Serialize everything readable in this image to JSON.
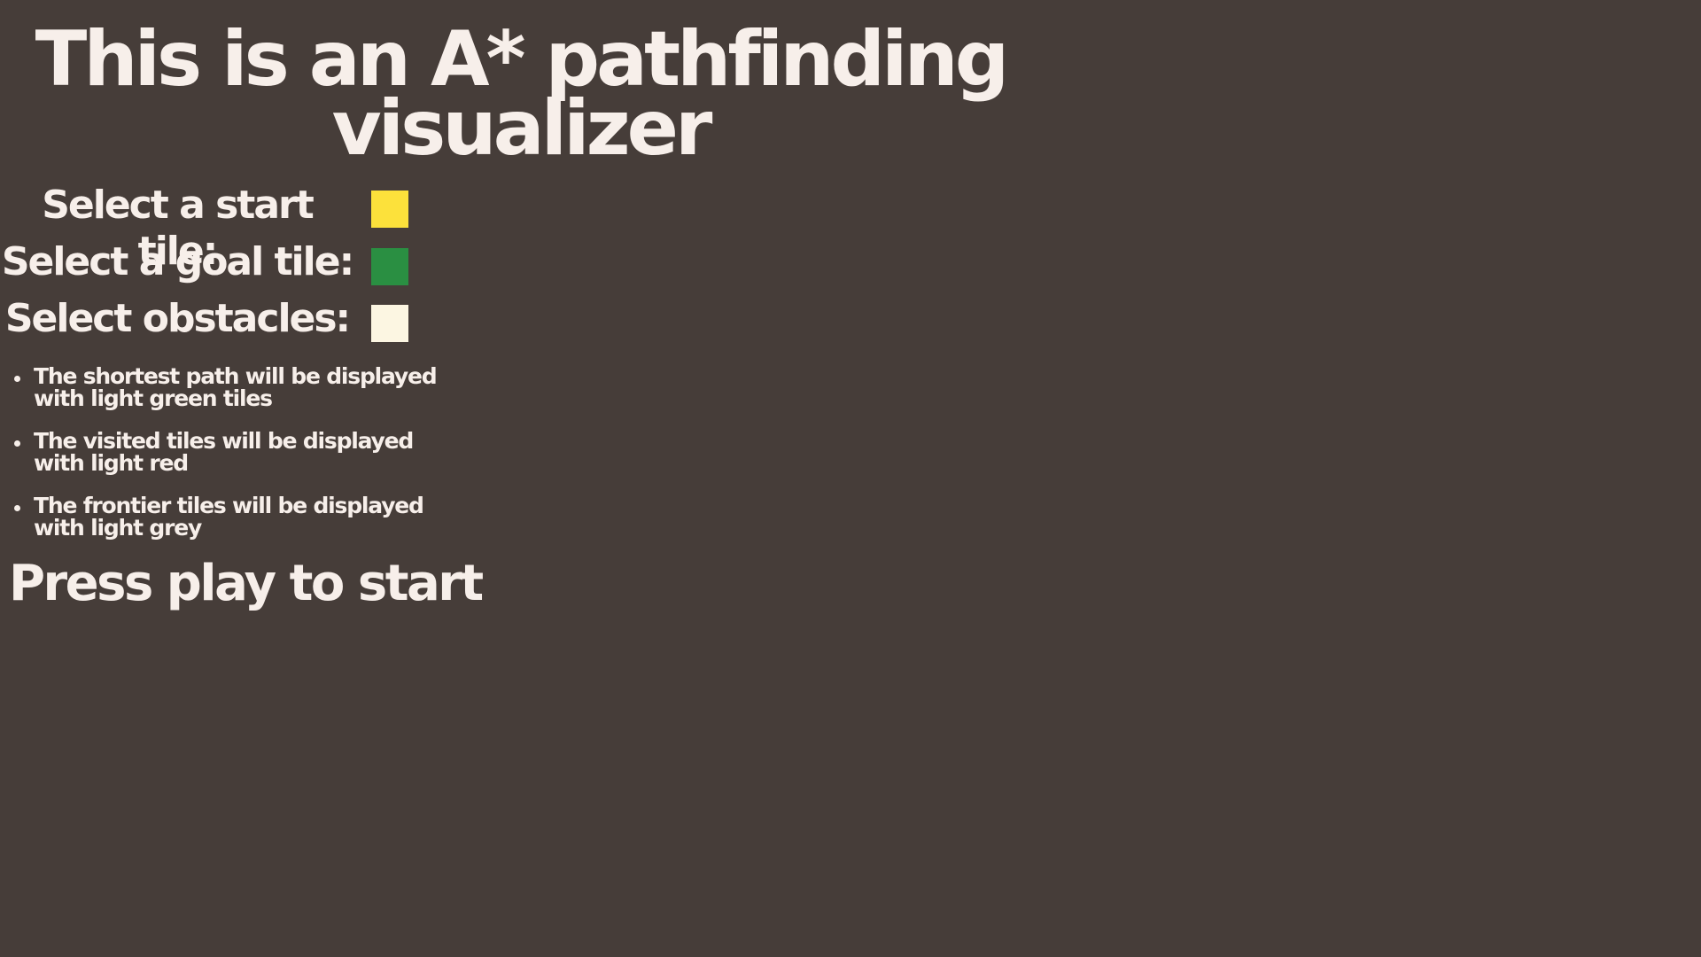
{
  "colors": {
    "background": "#463d39",
    "text": "#f7efea",
    "start_tile": "#fce13b",
    "goal_tile": "#2a8f42",
    "obstacle_tile": "#fcf6e2"
  },
  "title": {
    "line1": "This is an A* pathfinding",
    "line2": "visualizer"
  },
  "selectors": {
    "start": {
      "label": "Select a start tile:"
    },
    "goal": {
      "label": "Select a goal tile:"
    },
    "obstacles": {
      "label": "Select obstacles:"
    }
  },
  "legend": [
    {
      "line1": "The shortest path will be displayed",
      "line2": "with light green tiles"
    },
    {
      "line1": "The visited tiles will be displayed",
      "line2": "with light red"
    },
    {
      "line1": "The frontier tiles will be displayed",
      "line2": "with light grey"
    }
  ],
  "play_text": "Press play to start"
}
